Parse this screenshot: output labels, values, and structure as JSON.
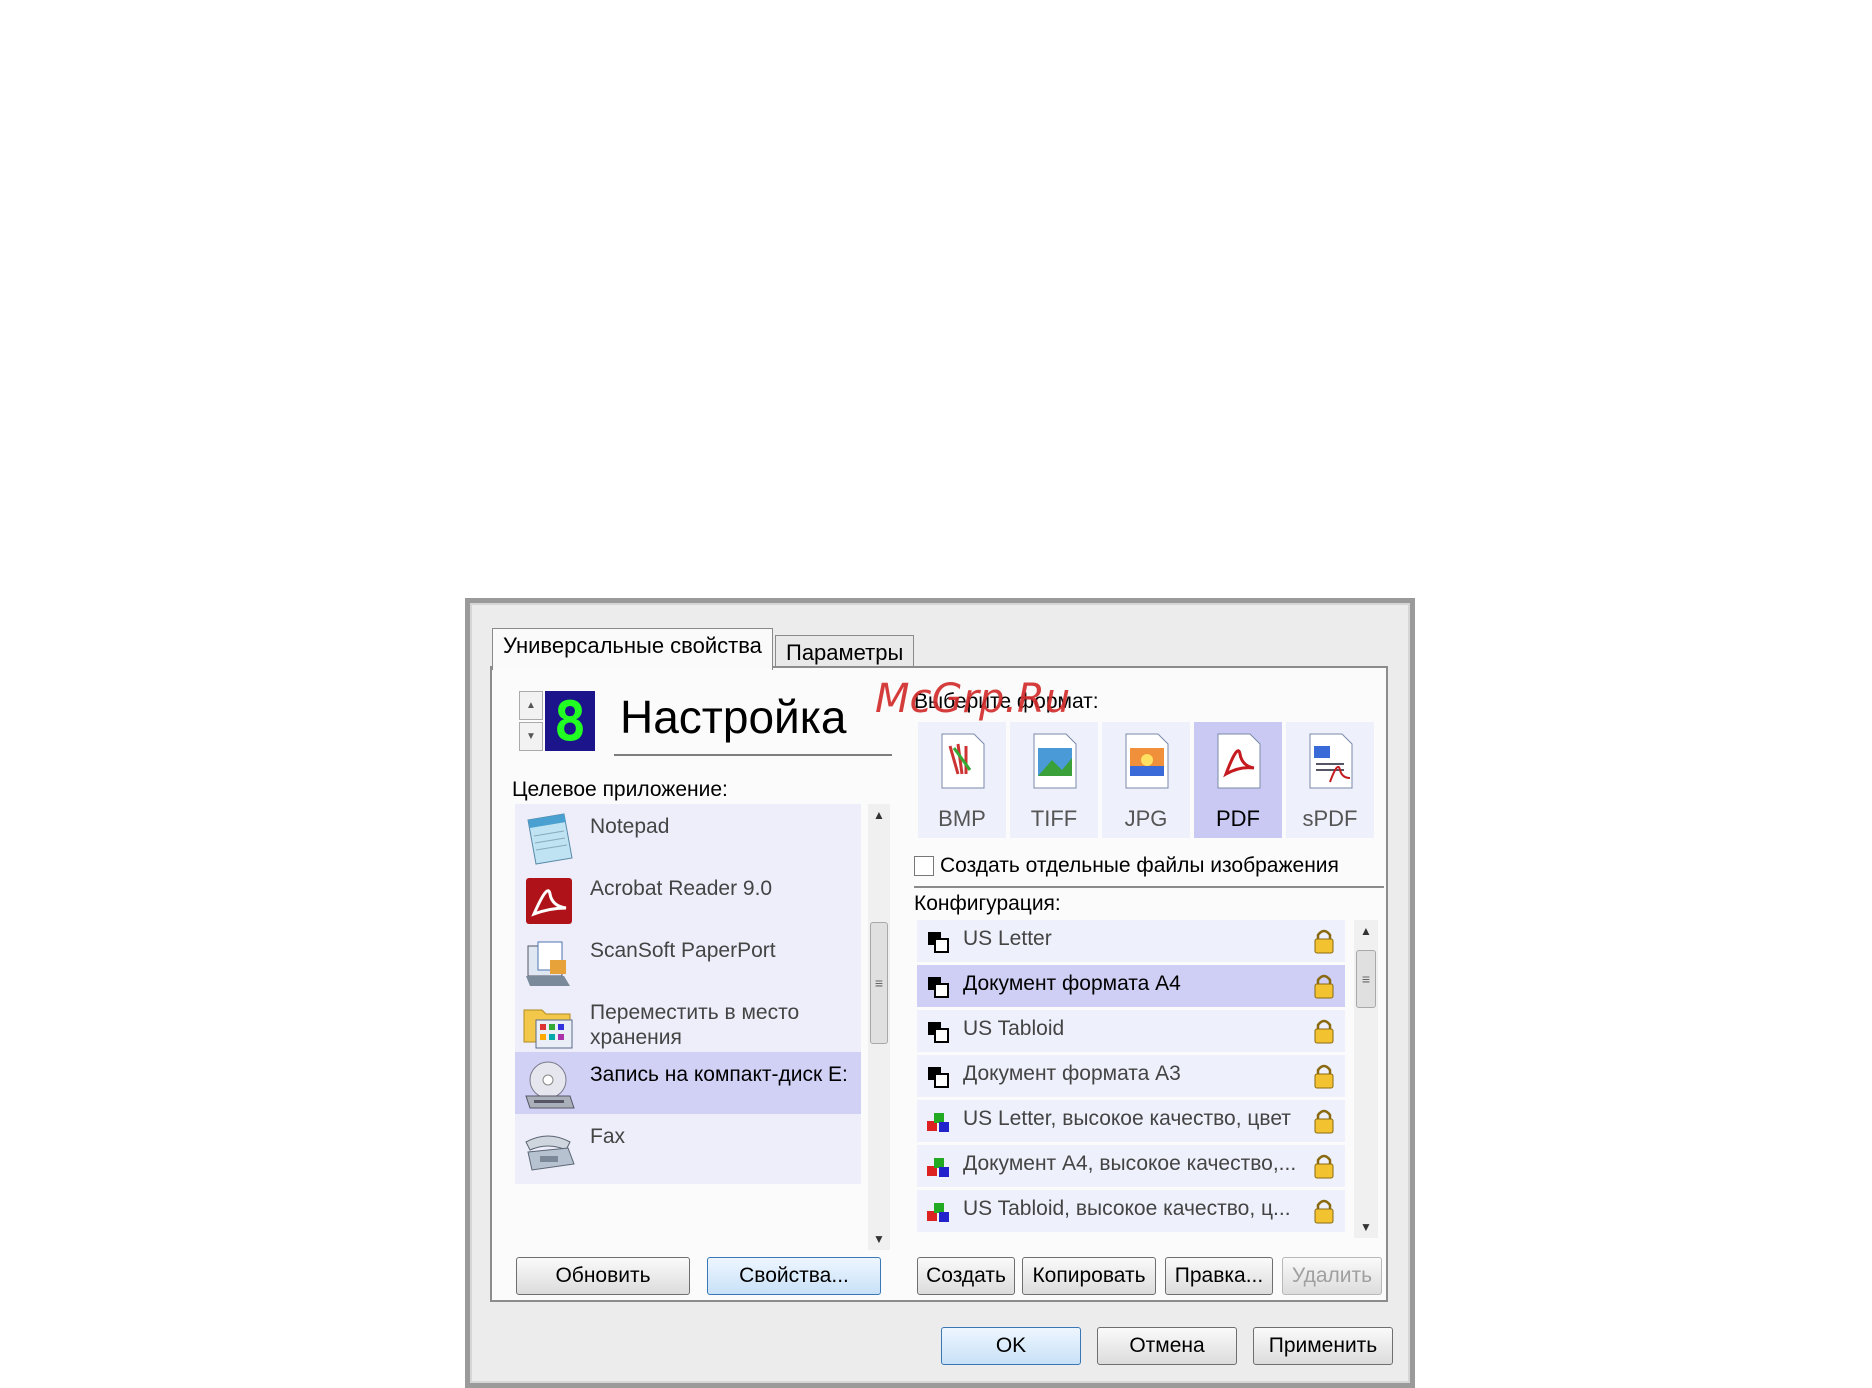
{
  "tabs": {
    "general": "Универсальные свойства",
    "parameters": "Параметры"
  },
  "profile": {
    "digit": "8",
    "title": "Настройка"
  },
  "target": {
    "label": "Целевое приложение:",
    "apps": [
      {
        "label": "Notepad",
        "icon": "notepad-icon"
      },
      {
        "label": "Acrobat Reader 9.0",
        "icon": "acrobat-icon"
      },
      {
        "label": "ScanSoft PaperPort",
        "icon": "paperport-icon"
      },
      {
        "label": "Переместить в место хранения",
        "icon": "folder-icon"
      },
      {
        "label": "Запись на компакт-диск E:",
        "icon": "cd-burn-icon",
        "selected": true
      },
      {
        "label": "Fax",
        "icon": "fax-icon"
      }
    ],
    "refresh_button": "Обновить",
    "properties_button": "Свойства..."
  },
  "format": {
    "label": "Выберите формат:",
    "options": [
      {
        "label": "BMP",
        "icon": "bmp-icon"
      },
      {
        "label": "TIFF",
        "icon": "tiff-icon"
      },
      {
        "label": "JPG",
        "icon": "jpg-icon"
      },
      {
        "label": "PDF",
        "icon": "pdf-icon",
        "selected": true
      },
      {
        "label": "sPDF",
        "icon": "spdf-icon"
      }
    ],
    "separate_files": "Создать отдельные файлы изображения"
  },
  "config": {
    "label": "Конфигурация:",
    "items": [
      {
        "label": "US Letter",
        "icon": "bw-icon"
      },
      {
        "label": "Документ формата А4",
        "icon": "bw-icon",
        "selected": true
      },
      {
        "label": "US Tabloid",
        "icon": "bw-icon"
      },
      {
        "label": "Документ формата А3",
        "icon": "bw-icon"
      },
      {
        "label": "US Letter, высокое качество, цвет",
        "icon": "color-icon"
      },
      {
        "label": "Документ А4, высокое качество,...",
        "icon": "color-icon"
      },
      {
        "label": "US Tabloid, высокое качество, ц...",
        "icon": "color-icon"
      }
    ],
    "new_button": "Создать",
    "copy_button": "Копировать",
    "edit_button": "Правка...",
    "delete_button": "Удалить"
  },
  "footer": {
    "ok": "OK",
    "cancel": "Отмена",
    "apply": "Применить"
  },
  "watermark": "McGrp.Ru",
  "colors": {
    "selection": "#d1d1f6",
    "list_bg": "#eeeefb",
    "digit_bg": "#1b148a",
    "digit_fg": "#22ff22",
    "watermark": "#d22c2c"
  }
}
